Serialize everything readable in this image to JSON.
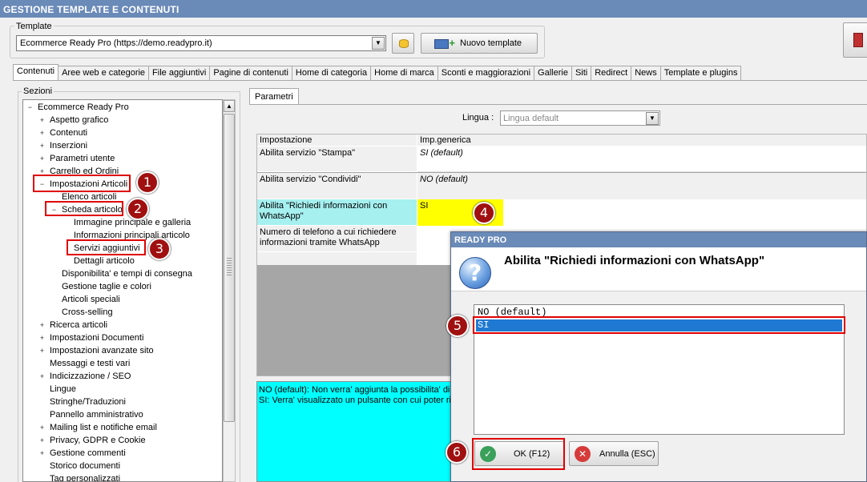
{
  "window": {
    "title": "GESTIONE TEMPLATE E CONTENUTI"
  },
  "template": {
    "label": "Template",
    "selected": "Ecommerce Ready Pro (https://demo.readypro.it)",
    "new_button": "Nuovo template"
  },
  "tabs": [
    "Contenuti",
    "Aree web e categorie",
    "File aggiuntivi",
    "Pagine di contenuti",
    "Home di categoria",
    "Home di marca",
    "Sconti e maggiorazioni",
    "Gallerie",
    "Siti",
    "Redirect",
    "News",
    "Template e plugins"
  ],
  "sidebar": {
    "label": "Sezioni",
    "tree": [
      {
        "label": "Ecommerce Ready Pro",
        "expander": "−"
      },
      {
        "label": "Aspetto grafico",
        "expander": "+"
      },
      {
        "label": "Contenuti",
        "expander": "+"
      },
      {
        "label": "Inserzioni",
        "expander": "+"
      },
      {
        "label": "Parametri utente",
        "expander": "+"
      },
      {
        "label": "Carrello ed Ordini",
        "expander": "+"
      },
      {
        "label": "Impostazioni Articoli",
        "expander": "−"
      },
      {
        "label": "Elenco articoli",
        "expander": ""
      },
      {
        "label": "Scheda articolo",
        "expander": "−"
      },
      {
        "label": "Immagine principale e galleria",
        "expander": ""
      },
      {
        "label": "Informazioni principali articolo",
        "expander": ""
      },
      {
        "label": "Servizi aggiuntivi",
        "expander": ""
      },
      {
        "label": "Dettagli articolo",
        "expander": ""
      },
      {
        "label": "Disponibilita' e tempi di consegna",
        "expander": ""
      },
      {
        "label": "Gestione taglie e colori",
        "expander": ""
      },
      {
        "label": "Articoli speciali",
        "expander": ""
      },
      {
        "label": "Cross-selling",
        "expander": ""
      },
      {
        "label": "Ricerca articoli",
        "expander": "+"
      },
      {
        "label": "Impostazioni Documenti",
        "expander": "+"
      },
      {
        "label": "Impostazioni avanzate sito",
        "expander": "+"
      },
      {
        "label": "Messaggi e testi vari",
        "expander": ""
      },
      {
        "label": "Indicizzazione / SEO",
        "expander": "+"
      },
      {
        "label": "Lingue",
        "expander": ""
      },
      {
        "label": "Stringhe/Traduzioni",
        "expander": ""
      },
      {
        "label": "Pannello amministrativo",
        "expander": ""
      },
      {
        "label": "Mailing list e notifiche email",
        "expander": "+"
      },
      {
        "label": "Privacy, GDPR e Cookie",
        "expander": "+"
      },
      {
        "label": "Gestione commenti",
        "expander": "+"
      },
      {
        "label": "Storico documenti",
        "expander": ""
      },
      {
        "label": "Tag personalizzati",
        "expander": ""
      }
    ]
  },
  "params": {
    "tab": "Parametri",
    "lingua_label": "Lingua :",
    "lingua_value": "Lingua default",
    "headers": [
      "Impostazione",
      "Imp.generica"
    ],
    "rows": [
      {
        "name": "Abilita servizio \"Stampa\"",
        "value": "SI (default)"
      },
      {
        "name": "Abilita servizio \"Condividi\"",
        "value": "NO (default)"
      },
      {
        "name": "Abilita \"Richiedi informazioni con WhatsApp\"",
        "value": "SI"
      },
      {
        "name": "Numero di telefono a cui richiedere informazioni tramite WhatsApp",
        "value": ""
      }
    ],
    "description": "NO (default): Non verra' aggiunta la possibilita' di r\nSI: Verra' visualizzato un pulsante con cui poter ric"
  },
  "dialog": {
    "title": "READY PRO",
    "question": "Abilita \"Richiedi informazioni con WhatsApp\"",
    "options": [
      "NO (default)",
      "SI"
    ],
    "selected": "SI",
    "ok": "OK (F12)",
    "cancel": "Annulla (ESC)"
  },
  "annotations": [
    "1",
    "2",
    "3",
    "4",
    "5",
    "6"
  ],
  "colors": {
    "titlebar": "#6a8ab8",
    "highlight_value": "#ffff00",
    "highlight_name": "#a6f0f0",
    "description_bg": "#00ffff",
    "selection": "#1f78d1",
    "callout": "#e00000"
  }
}
